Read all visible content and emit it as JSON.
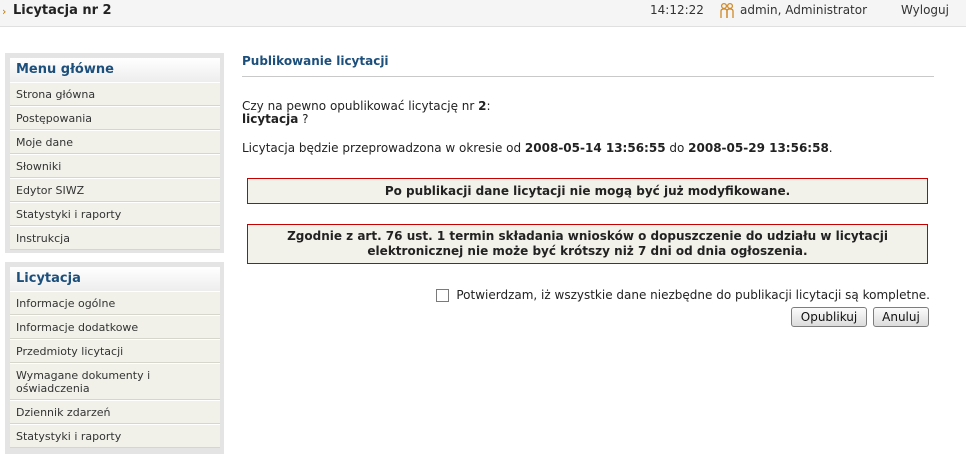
{
  "header": {
    "title": "Licytacja nr 2",
    "time": "14:12:22",
    "user": "admin, Administrator",
    "logout": "Wyloguj"
  },
  "menu_main": {
    "title": "Menu główne",
    "items": [
      "Strona główna",
      "Postępowania",
      "Moje dane",
      "Słowniki",
      "Edytor SIWZ",
      "Statystyki i raporty",
      "Instrukcja"
    ]
  },
  "menu_auction": {
    "title": "Licytacja",
    "items": [
      "Informacje ogólne",
      "Informacje dodatkowe",
      "Przedmioty licytacji",
      "Wymagane dokumenty i oświadczenia",
      "Dziennik zdarzeń",
      "Statystyki i raporty"
    ]
  },
  "main": {
    "heading": "Publikowanie licytacji",
    "question_prefix": "Czy na pewno opublikować licytację nr ",
    "auction_number": "2",
    "question_colon": ":",
    "auction_name": "licytacja",
    "question_mark": " ?",
    "period_prefix": "Licytacja będzie przeprowadzona w okresie od ",
    "date_from": "2008-05-14 13:56:55",
    "period_mid": " do ",
    "date_to": "2008-05-29 13:56:58",
    "period_end": ".",
    "warning1": "Po publikacji dane licytacji nie mogą być już modyfikowane.",
    "warning2_line1": "Zgodnie z art. 76 ust. 1 termin składania wniosków o dopuszczenie do udziału w licytacji",
    "warning2_line2": "elektronicznej nie może być krótszy niż 7 dni od dnia ogłoszenia.",
    "confirm_label": "Potwierdzam, iż wszystkie dane niezbędne do publikacji licytacji są kompletne.",
    "confirm_checked": false,
    "publish_button": "Opublikuj",
    "cancel_button": "Anuluj"
  },
  "colors": {
    "accent": "#1c4f7c",
    "warning_border": "#c40000",
    "menu_item_bg": "#f1f1ea"
  }
}
